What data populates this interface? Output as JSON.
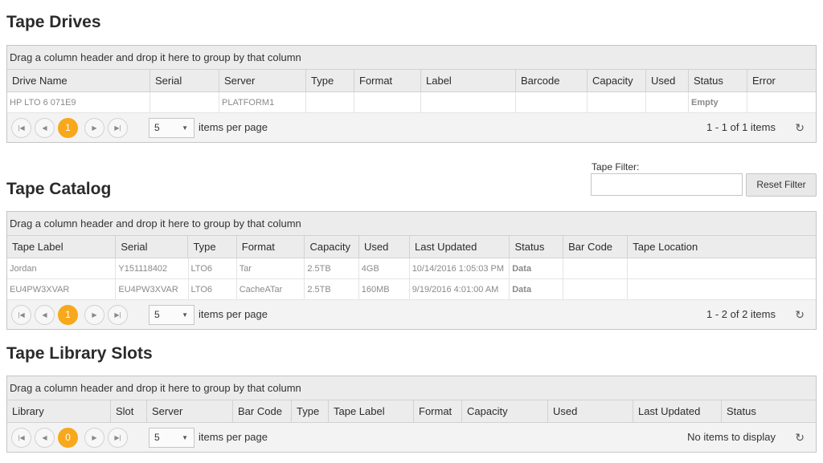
{
  "group_hint": "Drag a column header and drop it here to group by that column",
  "items_per_page_label": "items per page",
  "page_size": "5",
  "filter": {
    "label": "Tape Filter:",
    "value": "",
    "reset_label": "Reset Filter"
  },
  "drives": {
    "title": "Tape Drives",
    "columns": [
      "Drive Name",
      "Serial",
      "Server",
      "Type",
      "Format",
      "Label",
      "Barcode",
      "Capacity",
      "Used",
      "Status",
      "Error"
    ],
    "rows": [
      [
        "HP LTO 6 071E9",
        "",
        "PLATFORM1",
        "",
        "",
        "",
        "",
        "",
        "",
        "Empty",
        ""
      ]
    ],
    "current_page": "1",
    "page_info": "1 - 1 of 1 items"
  },
  "catalog": {
    "title": "Tape Catalog",
    "columns": [
      "Tape Label",
      "Serial",
      "Type",
      "Format",
      "Capacity",
      "Used",
      "Last Updated",
      "Status",
      "Bar Code",
      "Tape Location"
    ],
    "rows": [
      [
        "Jordan",
        "Y151118402",
        "LTO6",
        "Tar",
        "2.5TB",
        "4GB",
        "10/14/2016 1:05:03 PM",
        "Data",
        "",
        ""
      ],
      [
        "EU4PW3XVAR",
        "EU4PW3XVAR",
        "LTO6",
        "CacheATar",
        "2.5TB",
        "160MB",
        "9/19/2016 4:01:00 AM",
        "Data",
        "",
        ""
      ]
    ],
    "current_page": "1",
    "page_info": "1 - 2 of 2 items"
  },
  "slots": {
    "title": "Tape Library Slots",
    "columns": [
      "Library",
      "Slot",
      "Server",
      "Bar Code",
      "Type",
      "Tape Label",
      "Format",
      "Capacity",
      "Used",
      "Last Updated",
      "Status"
    ],
    "rows": [],
    "current_page": "0",
    "page_info": "No items to display"
  },
  "icons": {
    "first": "first-page-icon",
    "prev": "previous-page-icon",
    "next": "next-page-icon",
    "last": "last-page-icon",
    "dropdown": "chevron-down-icon",
    "refresh": "refresh-icon"
  },
  "colors": {
    "active_page": "#f7a81b",
    "header_bg": "#ececec",
    "pager_bg": "#f3f3f3"
  }
}
